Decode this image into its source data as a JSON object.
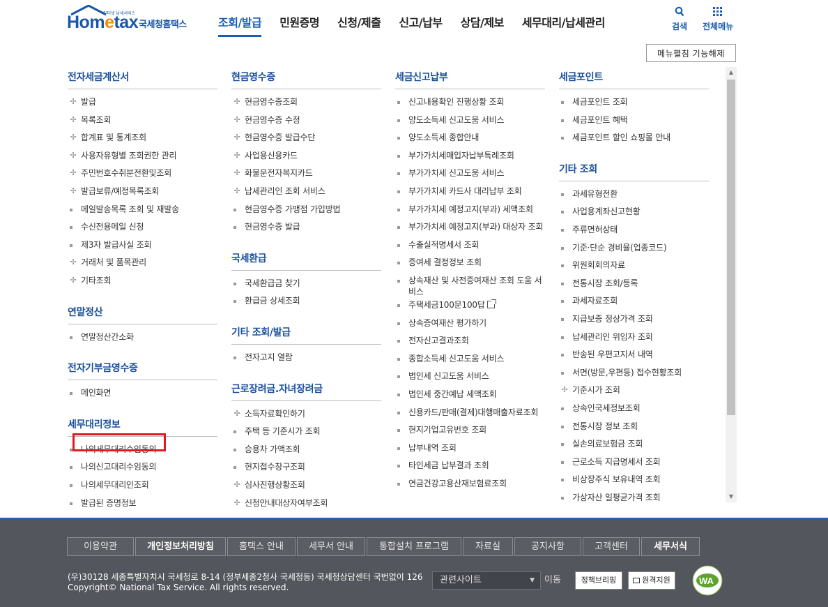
{
  "header": {
    "logo_text_1": "Hom",
    "logo_text_e": "e",
    "logo_text_2": "tax",
    "logo_tagline": "인터넷 납세서비스",
    "logo_sub": "국세청홈택스",
    "nav": [
      "조회/발급",
      "민원증명",
      "신청/제출",
      "신고/납부",
      "상담/제보",
      "세무대리/납세관리"
    ],
    "active_nav": "조회/발급",
    "search_label": "검색",
    "allmenu_label": "전체메뉴"
  },
  "menu_fold_button": "메뉴펼침 기능해제",
  "columns": [
    {
      "sections": [
        {
          "title": "전자세금계산서",
          "items": [
            {
              "label": "발급",
              "icon": "plus"
            },
            {
              "label": "목록조회",
              "icon": "plus"
            },
            {
              "label": "합계표 및 통계조회",
              "icon": "plus"
            },
            {
              "label": "사용자유형별 조회권한 관리",
              "icon": "plus"
            },
            {
              "label": "주민번호수취분전환및조회",
              "icon": "plus"
            },
            {
              "label": "발급보류/예정목록조회",
              "icon": "plus"
            },
            {
              "label": "메일발송목록 조회 및 재발송",
              "icon": "dot"
            },
            {
              "label": "수신전용메일 신청",
              "icon": "dot"
            },
            {
              "label": "제3자 발급사실 조회",
              "icon": "dot"
            },
            {
              "label": "거래처 및 품목관리",
              "icon": "plus"
            },
            {
              "label": "기타조회",
              "icon": "plus"
            }
          ]
        },
        {
          "title": "연말정산",
          "items": [
            {
              "label": "연말정산간소화",
              "icon": "dot"
            }
          ]
        },
        {
          "title": "전자기부금영수증",
          "items": [
            {
              "label": "메인화면",
              "icon": "dot"
            }
          ]
        },
        {
          "title": "세무대리정보",
          "items": [
            {
              "label": "나의세무대리수임동의",
              "icon": "dot"
            },
            {
              "label": "나의신고대리수임동의",
              "icon": "dot"
            },
            {
              "label": "나의세무대리인조회",
              "icon": "dot"
            },
            {
              "label": "발급된 증명정보",
              "icon": "dot"
            }
          ]
        }
      ]
    },
    {
      "sections": [
        {
          "title": "현금영수증",
          "items": [
            {
              "label": "현금영수증조회",
              "icon": "plus"
            },
            {
              "label": "현금영수증 수정",
              "icon": "plus"
            },
            {
              "label": "현금영수증 발급수단",
              "icon": "plus"
            },
            {
              "label": "사업용신용카드",
              "icon": "plus"
            },
            {
              "label": "화물운전자복지카드",
              "icon": "plus"
            },
            {
              "label": "납세관리인 조회 서비스",
              "icon": "plus"
            },
            {
              "label": "현금영수증 가맹점 가입방법",
              "icon": "dot"
            },
            {
              "label": "현금영수증 발급",
              "icon": "dot"
            }
          ]
        },
        {
          "title": "국세환급",
          "items": [
            {
              "label": "국세환급금 찾기",
              "icon": "dot"
            },
            {
              "label": "환급금 상세조회",
              "icon": "dot"
            }
          ]
        },
        {
          "title": "기타 조회/발급",
          "items": [
            {
              "label": "전자고지 열람",
              "icon": "dot"
            }
          ]
        },
        {
          "title": "근로장려금.자녀장려금",
          "items": [
            {
              "label": "소득자료확인하기",
              "icon": "plus"
            },
            {
              "label": "주택 등 기준시가 조회",
              "icon": "dot"
            },
            {
              "label": "승용차 가액조회",
              "icon": "dot"
            },
            {
              "label": "현지접수창구조회",
              "icon": "dot"
            },
            {
              "label": "심사진행상황조회",
              "icon": "plus"
            },
            {
              "label": "신청안내대상자여부조회",
              "icon": "plus"
            }
          ]
        }
      ]
    },
    {
      "sections": [
        {
          "title": "세금신고납부",
          "items": [
            {
              "label": "신고내용확인 진행상황 조회",
              "icon": "dot"
            },
            {
              "label": "양도소득세 신고도움 서비스",
              "icon": "dot"
            },
            {
              "label": "양도소득세 종합안내",
              "icon": "dot"
            },
            {
              "label": "부가가치세매입자납부특례조회",
              "icon": "dot"
            },
            {
              "label": "부가가치세 신고도움 서비스",
              "icon": "dot"
            },
            {
              "label": "부가가치세 카드사 대리납부 조회",
              "icon": "dot"
            },
            {
              "label": "부가가치세 예정고지(부과) 세액조회",
              "icon": "dot"
            },
            {
              "label": "부가가치세 예정고지(부과) 대상자 조회",
              "icon": "dot",
              "wrap": true
            },
            {
              "label": "수출실적명세서 조회",
              "icon": "dot"
            },
            {
              "label": "증여세 결정정보 조회",
              "icon": "dot"
            },
            {
              "label": "상속재산 및 사전증여재산 조회 도움 서비스",
              "icon": "dot",
              "wrap": true
            },
            {
              "label": "주택세금100문100답",
              "icon": "dot",
              "external": true
            },
            {
              "label": "상속증여재산 평가하기",
              "icon": "dot"
            },
            {
              "label": "전자신고결과조회",
              "icon": "dot"
            },
            {
              "label": "종합소득세 신고도움 서비스",
              "icon": "dot"
            },
            {
              "label": "법인세 신고도움 서비스",
              "icon": "dot"
            },
            {
              "label": "법인세 중간예납 세액조회",
              "icon": "dot"
            },
            {
              "label": "신용카드/판매(결제)대행매출자료조회",
              "icon": "dot"
            },
            {
              "label": "현지기업고유번호 조회",
              "icon": "dot"
            },
            {
              "label": "납부내역 조회",
              "icon": "dot"
            },
            {
              "label": "타인세금 납부결과 조회",
              "icon": "dot"
            },
            {
              "label": "연금건강고용산재보험료조회",
              "icon": "dot"
            }
          ]
        }
      ]
    },
    {
      "sections": [
        {
          "title": "세금포인트",
          "items": [
            {
              "label": "세금포인트 조회",
              "icon": "dot"
            },
            {
              "label": "세금포인트 혜택",
              "icon": "dot"
            },
            {
              "label": "세금포인트 할인 쇼핑몰 안내",
              "icon": "dot"
            }
          ]
        },
        {
          "title": "기타 조회",
          "items": [
            {
              "label": "과세유형전환",
              "icon": "dot"
            },
            {
              "label": "사업용계좌신고현황",
              "icon": "dot"
            },
            {
              "label": "주류면허상태",
              "icon": "dot"
            },
            {
              "label": "기준·단순 경비율(업종코드)",
              "icon": "dot"
            },
            {
              "label": "위원회회의자료",
              "icon": "dot"
            },
            {
              "label": "전통시장 조회/등록",
              "icon": "dot"
            },
            {
              "label": "과세자료조회",
              "icon": "dot"
            },
            {
              "label": "지급보증 정상가격 조회",
              "icon": "dot"
            },
            {
              "label": "납세관리인 위임자 조회",
              "icon": "dot"
            },
            {
              "label": "반송된 우편고지서 내역",
              "icon": "dot"
            },
            {
              "label": "서면(방문,우편등) 접수현황조회",
              "icon": "dot"
            },
            {
              "label": "기준시가 조회",
              "icon": "plus"
            },
            {
              "label": "상속인국세정보조회",
              "icon": "dot"
            },
            {
              "label": "전통시장 정보 조회",
              "icon": "dot"
            },
            {
              "label": "실손의료보험금 조회",
              "icon": "dot"
            },
            {
              "label": "근로소득 지급명세서 조회",
              "icon": "dot"
            },
            {
              "label": "비상장주식 보유내역 조회",
              "icon": "dot"
            },
            {
              "label": "가상자산 일평균가격 조회",
              "icon": "dot"
            }
          ]
        }
      ]
    }
  ],
  "footer": {
    "nav": [
      {
        "label": "이용약관",
        "bold": false
      },
      {
        "label": "개인정보처리방침",
        "bold": true
      },
      {
        "label": "홈택스 안내",
        "bold": false
      },
      {
        "label": "세무서 안내",
        "bold": false
      },
      {
        "label": "통합설치 프로그램",
        "bold": false
      },
      {
        "label": "자료실",
        "bold": false
      },
      {
        "label": "공지사항",
        "bold": false
      },
      {
        "label": "고객센터",
        "bold": false
      },
      {
        "label": "세무서식",
        "bold": true
      }
    ],
    "address": "(우)30128 세종특별자치시 국세청로 8-14 (정부세종2청사 국세청동) 국세청상담센터 국번없이 126",
    "copyright": "Copyright© National Tax Service. All rights reserved.",
    "related_site": "관련사이트",
    "go_label": "이동",
    "policy_brief": "정책브리핑",
    "remote_support": "원격지원",
    "wa_mark": "WA",
    "colors": {
      "bg": "#53565c",
      "line": "#2a5fb0"
    }
  },
  "colors": {
    "brand": "#1a56a8",
    "accent": "#f08c00",
    "active_nav": "#1a5eb0",
    "highlight": "#e3191f"
  }
}
